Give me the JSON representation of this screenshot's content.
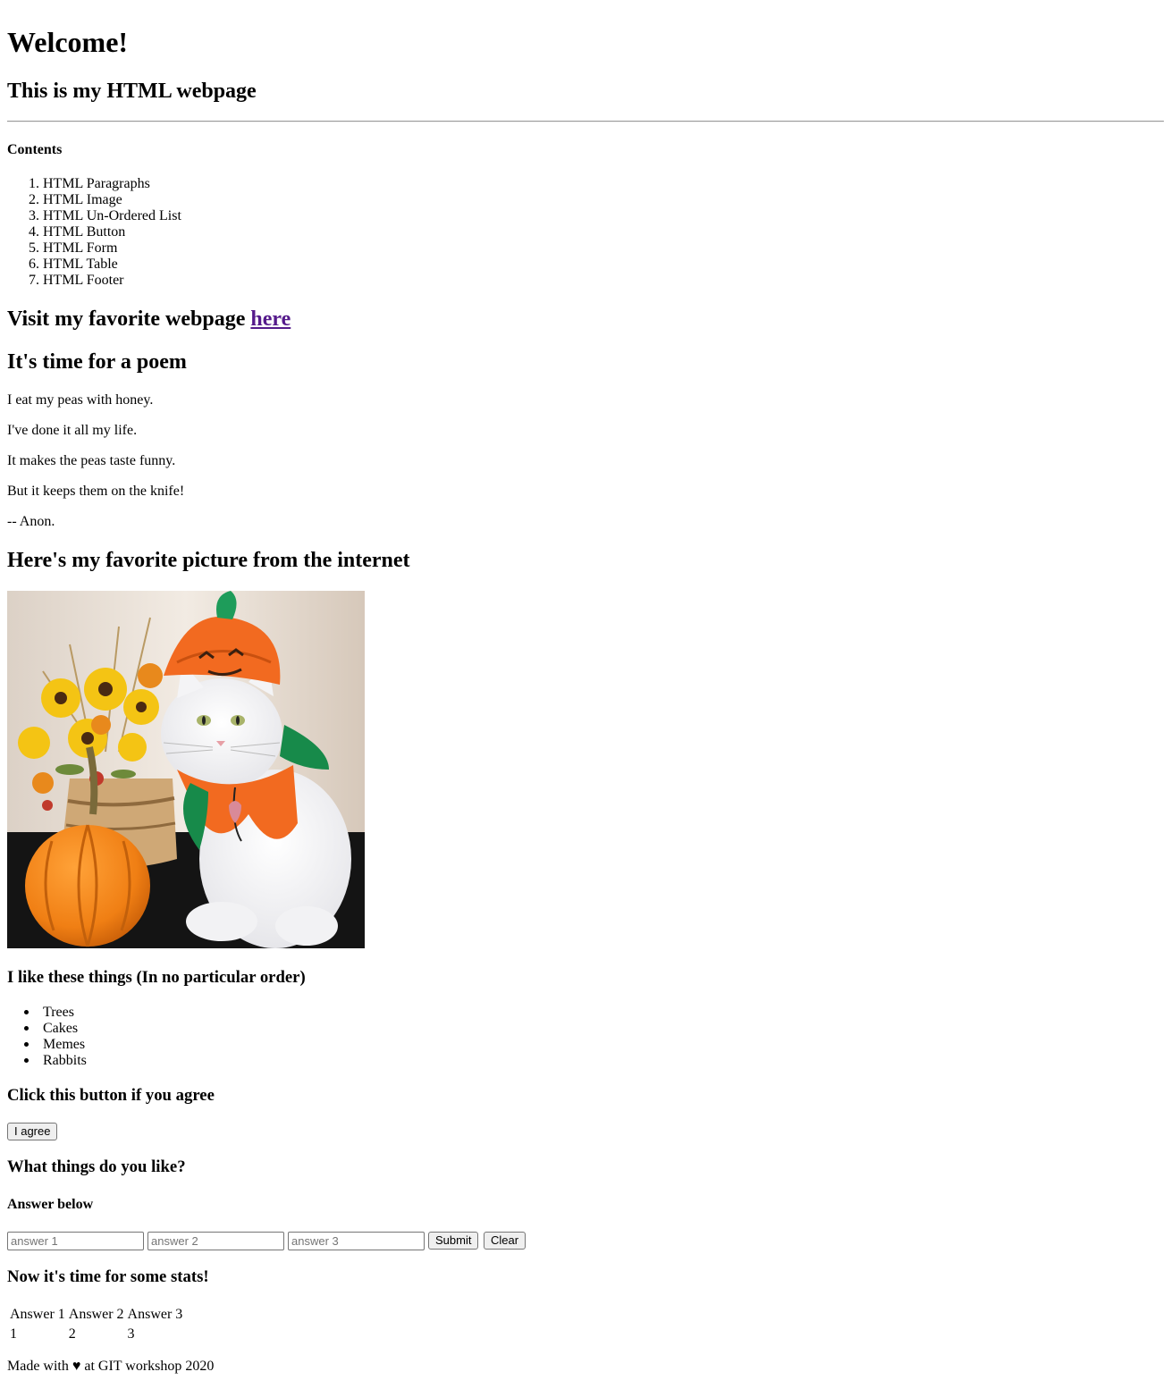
{
  "header": {
    "title": "Welcome!",
    "subtitle": "This is my HTML webpage"
  },
  "contents": {
    "heading": "Contents",
    "items": [
      "HTML Paragraphs",
      "HTML Image",
      "HTML Un-Ordered List",
      "HTML Button",
      "HTML Form",
      "HTML Table",
      "HTML Footer"
    ]
  },
  "favorite_site": {
    "text": "Visit my favorite webpage",
    "link_text": "here"
  },
  "poem": {
    "heading": "It's time for a poem",
    "lines": [
      "I eat my peas with honey.",
      "I've done it all my life.",
      "It makes the peas taste funny.",
      "But it keeps them on the knife!",
      "-- Anon."
    ]
  },
  "picture": {
    "heading": "Here's my favorite picture from the internet"
  },
  "likes": {
    "heading": "I like these things (In no particular order)",
    "items": [
      "Trees",
      "Cakes",
      "Memes",
      "Rabbits"
    ]
  },
  "agree": {
    "heading": "Click this button if you agree",
    "button": "I agree"
  },
  "form": {
    "heading": "What things do you like?",
    "subheading": "Answer below",
    "inputs": [
      {
        "placeholder": "answer 1",
        "value": ""
      },
      {
        "placeholder": "answer 2",
        "value": ""
      },
      {
        "placeholder": "answer 3",
        "value": ""
      }
    ],
    "submit": "Submit",
    "clear": "Clear"
  },
  "stats": {
    "heading": "Now it's time for some stats!",
    "headers": [
      "Answer 1",
      "Answer 2",
      "Answer 3"
    ],
    "row": [
      "1",
      "2",
      "3"
    ]
  },
  "footer": {
    "text": "Made with ♥ at GIT workshop 2020"
  }
}
